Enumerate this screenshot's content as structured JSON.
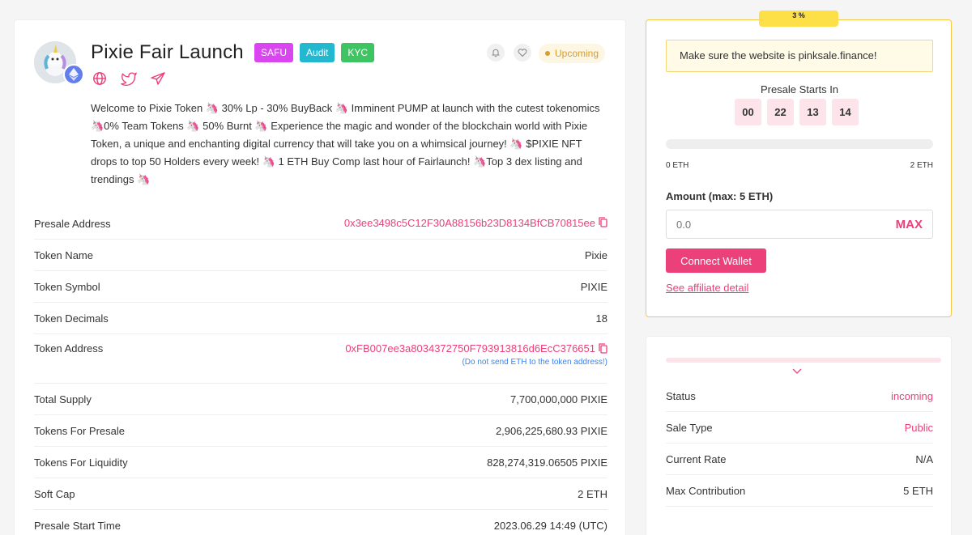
{
  "header": {
    "title": "Pixie Fair Launch",
    "badges": [
      "SAFU",
      "Audit",
      "KYC"
    ],
    "status": "Upcoming"
  },
  "description": "Welcome to Pixie Token 🦄 30% Lp - 30% BuyBack 🦄 Imminent PUMP at launch with the cutest tokenomics 🦄0% Team Tokens 🦄 50% Burnt 🦄 Experience the magic and wonder of the blockchain world with Pixie Token, a unique and enchanting digital currency that will take you on a whimsical journey! 🦄 $PIXIE NFT drops to top 50 Holders every week! 🦄 1 ETH Buy Comp last hour of Fairlaunch! 🦄Top 3 dex listing and trendings 🦄",
  "details": [
    {
      "label": "Presale Address",
      "value": "0x3ee3498c5C12F30A88156b23D8134BfCB70815ee"
    },
    {
      "label": "Token Name",
      "value": "Pixie"
    },
    {
      "label": "Token Symbol",
      "value": "PIXIE"
    },
    {
      "label": "Token Decimals",
      "value": "18"
    },
    {
      "label": "Token Address",
      "value": "0xFB007ee3a8034372750F793913816d6EcC376651",
      "note": "(Do not send ETH to the token address!)"
    },
    {
      "label": "Total Supply",
      "value": "7,700,000,000 PIXIE"
    },
    {
      "label": "Tokens For Presale",
      "value": "2,906,225,680.93 PIXIE"
    },
    {
      "label": "Tokens For Liquidity",
      "value": "828,274,319.06505 PIXIE"
    },
    {
      "label": "Soft Cap",
      "value": "2 ETH"
    },
    {
      "label": "Presale Start Time",
      "value": "2023.06.29 14:49 (UTC)"
    }
  ],
  "sale": {
    "percent_tab": "3 %",
    "warning": "Make sure the website is pinksale.finance!",
    "starts_label": "Presale Starts In",
    "countdown": [
      "00",
      "22",
      "13",
      "14"
    ],
    "progress_fraction": 0,
    "progress_min": "0 ETH",
    "progress_max": "2 ETH",
    "amount_label": "Amount (max: 5 ETH)",
    "amount_placeholder": "0.0",
    "max_label": "MAX",
    "connect_label": "Connect Wallet",
    "affiliate_label": "See affiliate detail"
  },
  "info": [
    {
      "label": "Status",
      "value": "incoming"
    },
    {
      "label": "Sale Type",
      "value": "Public"
    },
    {
      "label": "Current Rate",
      "value": "N/A"
    },
    {
      "label": "Max Contribution",
      "value": "5 ETH"
    }
  ],
  "colors": {
    "accent": "#ec407a",
    "status": "#d69e2e"
  }
}
